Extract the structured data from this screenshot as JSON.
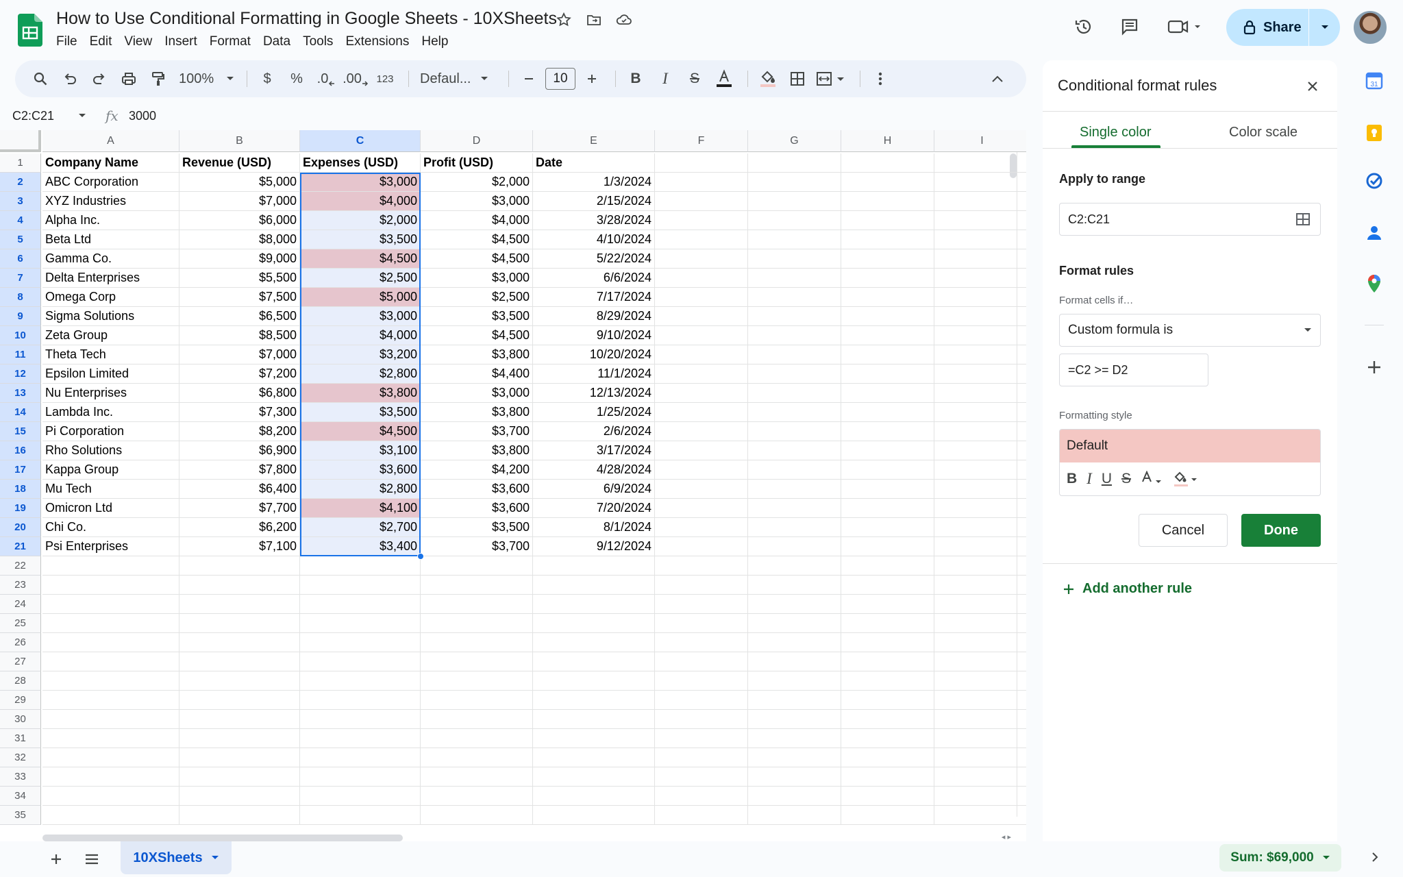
{
  "window": {
    "doc_title": "How to Use Conditional Formatting in Google Sheets - 10XSheets"
  },
  "menu": [
    "File",
    "Edit",
    "View",
    "Insert",
    "Format",
    "Data",
    "Tools",
    "Extensions",
    "Help"
  ],
  "share": {
    "label": "Share"
  },
  "toolbar": {
    "zoom": "100%",
    "currency": "$",
    "percent": "%",
    "dec_decrease": ".0",
    "dec_increase": ".00",
    "number_format": "123",
    "font": "Defaul...",
    "font_size": "10"
  },
  "formula_bar": {
    "name_box": "C2:C21",
    "fx": "fx",
    "value": "3000"
  },
  "sheet": {
    "columns": [
      "A",
      "B",
      "C",
      "D",
      "E",
      "F",
      "G",
      "H",
      "I"
    ],
    "selected_column": "C",
    "header_row": [
      "Company Name",
      "Revenue (USD)",
      "Expenses (USD)",
      "Profit (USD)",
      "Date"
    ],
    "rows": [
      [
        "ABC Corporation",
        "$5,000",
        "$3,000",
        "$2,000",
        "1/3/2024"
      ],
      [
        "XYZ Industries",
        "$7,000",
        "$4,000",
        "$3,000",
        "2/15/2024"
      ],
      [
        "Alpha Inc.",
        "$6,000",
        "$2,000",
        "$4,000",
        "3/28/2024"
      ],
      [
        "Beta Ltd",
        "$8,000",
        "$3,500",
        "$4,500",
        "4/10/2024"
      ],
      [
        "Gamma Co.",
        "$9,000",
        "$4,500",
        "$4,500",
        "5/22/2024"
      ],
      [
        "Delta Enterprises",
        "$5,500",
        "$2,500",
        "$3,000",
        "6/6/2024"
      ],
      [
        "Omega Corp",
        "$7,500",
        "$5,000",
        "$2,500",
        "7/17/2024"
      ],
      [
        "Sigma Solutions",
        "$6,500",
        "$3,000",
        "$3,500",
        "8/29/2024"
      ],
      [
        "Zeta Group",
        "$8,500",
        "$4,000",
        "$4,500",
        "9/10/2024"
      ],
      [
        "Theta Tech",
        "$7,000",
        "$3,200",
        "$3,800",
        "10/20/2024"
      ],
      [
        "Epsilon Limited",
        "$7,200",
        "$2,800",
        "$4,400",
        "11/1/2024"
      ],
      [
        "Nu Enterprises",
        "$6,800",
        "$3,800",
        "$3,000",
        "12/13/2024"
      ],
      [
        "Lambda Inc.",
        "$7,300",
        "$3,500",
        "$3,800",
        "1/25/2024"
      ],
      [
        "Pi Corporation",
        "$8,200",
        "$4,500",
        "$3,700",
        "2/6/2024"
      ],
      [
        "Rho Solutions",
        "$6,900",
        "$3,100",
        "$3,800",
        "3/17/2024"
      ],
      [
        "Kappa Group",
        "$7,800",
        "$3,600",
        "$4,200",
        "4/28/2024"
      ],
      [
        "Mu Tech",
        "$6,400",
        "$2,800",
        "$3,600",
        "6/9/2024"
      ],
      [
        "Omicron Ltd",
        "$7,700",
        "$4,100",
        "$3,600",
        "7/20/2024"
      ],
      [
        "Chi Co.",
        "$6,200",
        "$2,700",
        "$3,500",
        "8/1/2024"
      ],
      [
        "Psi Enterprises",
        "$7,100",
        "$3,400",
        "$3,700",
        "9/12/2024"
      ]
    ],
    "highlighted_rows": [
      2,
      3,
      6,
      8,
      13,
      15,
      19
    ],
    "visible_row_count": 35,
    "highlight_color": "#e6c5cd",
    "selection_color": "#e8eefb",
    "tab_name": "10XSheets",
    "sum_label": "Sum: $69,000"
  },
  "panel": {
    "title": "Conditional format rules",
    "tab_single": "Single color",
    "tab_scale": "Color scale",
    "apply_label": "Apply to range",
    "range_value": "C2:C21",
    "rules_label": "Format rules",
    "cells_if_label": "Format cells if…",
    "condition": "Custom formula is",
    "formula": "=C2 >= D2",
    "style_label": "Formatting style",
    "style_preview": "Default",
    "preview_color": "#f4c7c3",
    "cancel": "Cancel",
    "done": "Done",
    "add_rule": "Add another rule",
    "accent_color": "#188038"
  }
}
